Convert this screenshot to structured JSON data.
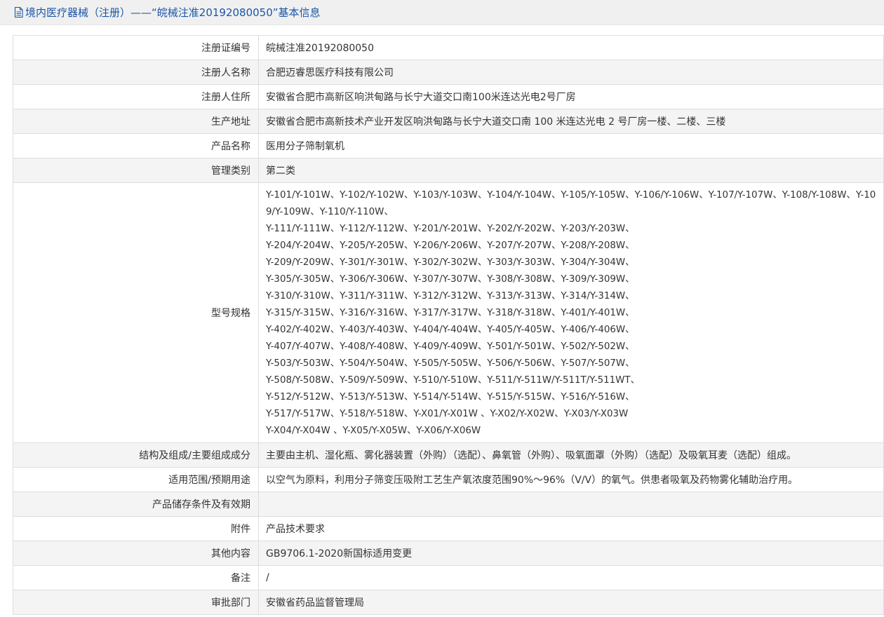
{
  "header": {
    "title": "境内医疗器械（注册）——“皖械注准20192080050”基本信息"
  },
  "rows": {
    "reg_no": {
      "label": "注册证编号",
      "value": "皖械注准20192080050"
    },
    "registrant": {
      "label": "注册人名称",
      "value": "合肥迈睿思医疗科技有限公司"
    },
    "registrant_address": {
      "label": "注册人住所",
      "value": "安徽省合肥市高新区响洪甸路与长宁大道交口南100米连达光电2号厂房"
    },
    "production_address": {
      "label": "生产地址",
      "value": "安徽省合肥市高新技术产业开发区响洪甸路与长宁大道交口南 100 米连达光电 2 号厂房一楼、二楼、三楼"
    },
    "product_name": {
      "label": "产品名称",
      "value": "医用分子筛制氧机"
    },
    "category": {
      "label": "管理类别",
      "value": "第二类"
    },
    "models": {
      "label": "型号规格",
      "lines": [
        "Y-101/Y-101W、Y-102/Y-102W、Y-103/Y-103W、Y-104/Y-104W、Y-105/Y-105W、Y-106/Y-106W、Y-107/Y-107W、Y-108/Y-108W、Y-109/Y-109W、Y-110/Y-110W、",
        "Y-111/Y-111W、Y-112/Y-112W、Y-201/Y-201W、Y-202/Y-202W、Y-203/Y-203W、",
        "Y-204/Y-204W、Y-205/Y-205W、Y-206/Y-206W、Y-207/Y-207W、Y-208/Y-208W、",
        "Y-209/Y-209W、Y-301/Y-301W、Y-302/Y-302W、Y-303/Y-303W、Y-304/Y-304W、",
        "Y-305/Y-305W、Y-306/Y-306W、Y-307/Y-307W、Y-308/Y-308W、Y-309/Y-309W、",
        "Y-310/Y-310W、Y-311/Y-311W、Y-312/Y-312W、Y-313/Y-313W、Y-314/Y-314W、",
        "Y-315/Y-315W、Y-316/Y-316W、Y-317/Y-317W、Y-318/Y-318W、Y-401/Y-401W、",
        "Y-402/Y-402W、Y-403/Y-403W、Y-404/Y-404W、Y-405/Y-405W、Y-406/Y-406W、",
        "Y-407/Y-407W、Y-408/Y-408W、Y-409/Y-409W、Y-501/Y-501W、Y-502/Y-502W、",
        "Y-503/Y-503W、Y-504/Y-504W、Y-505/Y-505W、Y-506/Y-506W、Y-507/Y-507W、",
        "Y-508/Y-508W、Y-509/Y-509W、Y-510/Y-510W、Y-511/Y-511W/Y-511T/Y-511WT、",
        "Y-512/Y-512W、Y-513/Y-513W、Y-514/Y-514W、Y-515/Y-515W、Y-516/Y-516W、",
        "Y-517/Y-517W、Y-518/Y-518W、Y-X01/Y-X01W 、Y-X02/Y-X02W、Y-X03/Y-X03W",
        "Y-X04/Y-X04W 、Y-X05/Y-X05W、Y-X06/Y-X06W"
      ]
    },
    "composition": {
      "label": "结构及组成/主要组成成分",
      "value": "主要由主机、湿化瓶、雾化器装置（外购）（选配）、鼻氧管（外购）、吸氧面罩（外购）（选配）及吸氧耳麦（选配）组成。"
    },
    "intended_use": {
      "label": "适用范围/预期用途",
      "value": "以空气为原料，利用分子筛变压吸附工艺生产氧浓度范围90%～96%（V/V）的氧气。供患者吸氧及药物雾化辅助治疗用。"
    },
    "storage": {
      "label": "产品储存条件及有效期",
      "value": ""
    },
    "attachment": {
      "label": "附件",
      "value": "产品技术要求"
    },
    "other": {
      "label": "其他内容",
      "value": "GB9706.1-2020新国标适用变更"
    },
    "remark": {
      "label": "备注",
      "value": "/"
    },
    "approval_dept": {
      "label": "审批部门",
      "value": "安徽省药品监督管理局"
    }
  }
}
